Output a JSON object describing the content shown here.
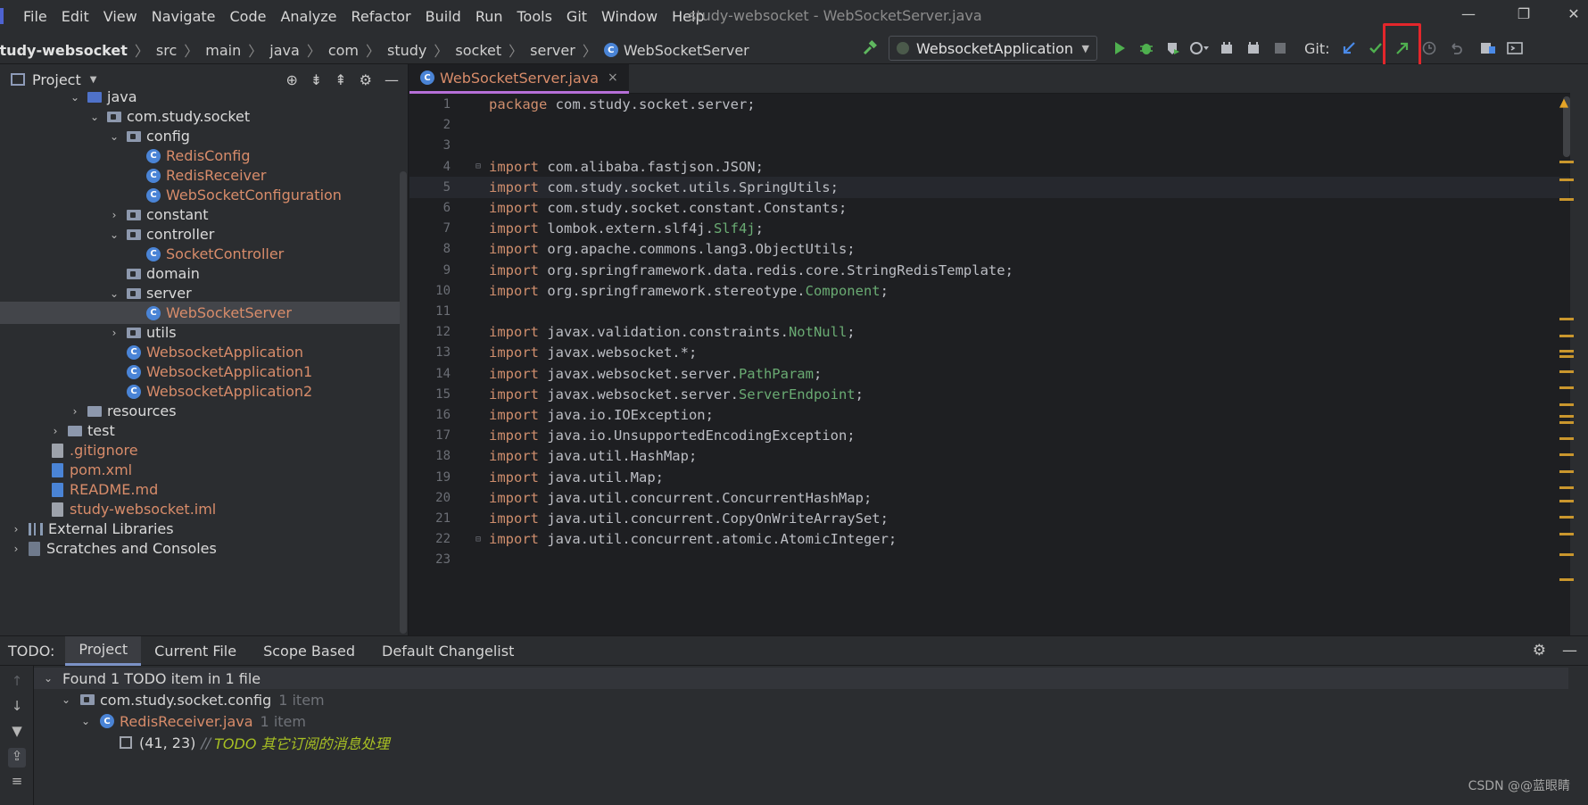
{
  "menu": {
    "items": [
      "File",
      "Edit",
      "View",
      "Navigate",
      "Code",
      "Analyze",
      "Refactor",
      "Build",
      "Run",
      "Tools",
      "Git",
      "Window",
      "Help"
    ],
    "window_title": "study-websocket - WebSocketServer.java",
    "minimize": "—",
    "restore": "❐",
    "close": "✕"
  },
  "breadcrumb": {
    "project": "study-websocket",
    "parts": [
      "src",
      "main",
      "java",
      "com",
      "study",
      "socket",
      "server"
    ],
    "class_icon": "C",
    "current": "WebSocketServer"
  },
  "toolbar": {
    "run_config": "WebsocketApplication",
    "git_label": "Git:",
    "icons": [
      "hammer-icon",
      "run-icon",
      "debug-icon",
      "coverage-icon",
      "profile-icon",
      "build-icon",
      "stop-icon",
      "git-update-icon",
      "git-commit-icon",
      "git-push-icon",
      "history-icon",
      "rollback-icon",
      "project-structure-icon",
      "terminal-icon"
    ]
  },
  "project_panel": {
    "title": "Project",
    "tree": [
      {
        "label": "java",
        "kind": "src-folder",
        "expanded": true
      },
      {
        "label": "com.study.socket",
        "kind": "package",
        "expanded": true
      },
      {
        "label": "config",
        "kind": "package",
        "expanded": true
      },
      {
        "label": "RedisConfig",
        "kind": "class"
      },
      {
        "label": "RedisReceiver",
        "kind": "class"
      },
      {
        "label": "WebSocketConfiguration",
        "kind": "class"
      },
      {
        "label": "constant",
        "kind": "package",
        "expanded": false
      },
      {
        "label": "controller",
        "kind": "package",
        "expanded": true
      },
      {
        "label": "SocketController",
        "kind": "class"
      },
      {
        "label": "domain",
        "kind": "package"
      },
      {
        "label": "server",
        "kind": "package",
        "expanded": true
      },
      {
        "label": "WebSocketServer",
        "kind": "class",
        "selected": true
      },
      {
        "label": "utils",
        "kind": "package",
        "expanded": false
      },
      {
        "label": "WebsocketApplication",
        "kind": "app-class"
      },
      {
        "label": "WebsocketApplication1",
        "kind": "app-class"
      },
      {
        "label": "WebsocketApplication2",
        "kind": "app-class"
      },
      {
        "label": "resources",
        "kind": "folder",
        "expanded": false
      },
      {
        "label": "test",
        "kind": "folder",
        "expanded": false
      },
      {
        "label": ".gitignore",
        "kind": "file"
      },
      {
        "label": "pom.xml",
        "kind": "file"
      },
      {
        "label": "README.md",
        "kind": "file"
      },
      {
        "label": "study-websocket.iml",
        "kind": "file"
      },
      {
        "label": "External Libraries",
        "kind": "library",
        "expanded": false
      },
      {
        "label": "Scratches and Consoles",
        "kind": "scratch",
        "expanded": false
      }
    ]
  },
  "editor": {
    "tab_label": "WebSocketServer.java",
    "tab_close": "×",
    "lines": [
      {
        "num": "1",
        "parts": [
          [
            "kw",
            "package"
          ],
          [
            "",
            "  com.study.socket.server;"
          ]
        ]
      },
      {
        "num": "2",
        "parts": []
      },
      {
        "num": "3",
        "parts": []
      },
      {
        "num": "4",
        "parts": [
          [
            "kw",
            "import"
          ],
          [
            "",
            "  com.alibaba.fastjson.JSON;"
          ]
        ]
      },
      {
        "num": "5",
        "parts": [
          [
            "kw",
            "import"
          ],
          [
            "",
            "  com.study.socket.utils.SpringUtils;"
          ]
        ]
      },
      {
        "num": "6",
        "parts": [
          [
            "kw",
            "import"
          ],
          [
            "",
            "  com.study.socket.constant.Constants;"
          ]
        ]
      },
      {
        "num": "7",
        "parts": [
          [
            "kw",
            "import"
          ],
          [
            "",
            "  lombok.extern.slf4j."
          ],
          [
            "ann",
            "Slf4j"
          ],
          [
            "",
            ";"
          ]
        ]
      },
      {
        "num": "8",
        "parts": [
          [
            "kw",
            "import"
          ],
          [
            "",
            "  org.apache.commons.lang3.ObjectUtils;"
          ]
        ]
      },
      {
        "num": "9",
        "parts": [
          [
            "kw",
            "import"
          ],
          [
            "",
            "  org.springframework.data.redis.core.StringRedisTemplate;"
          ]
        ]
      },
      {
        "num": "10",
        "parts": [
          [
            "kw",
            "import"
          ],
          [
            "",
            "  org.springframework.stereotype."
          ],
          [
            "ann",
            "Component"
          ],
          [
            "",
            ";"
          ]
        ]
      },
      {
        "num": "11",
        "parts": []
      },
      {
        "num": "12",
        "parts": [
          [
            "kw",
            "import"
          ],
          [
            "",
            "  javax.validation.constraints."
          ],
          [
            "ann",
            "NotNull"
          ],
          [
            "",
            ";"
          ]
        ]
      },
      {
        "num": "13",
        "parts": [
          [
            "kw",
            "import"
          ],
          [
            "",
            "  javax.websocket.*;"
          ]
        ]
      },
      {
        "num": "14",
        "parts": [
          [
            "kw",
            "import"
          ],
          [
            "",
            "  javax.websocket.server."
          ],
          [
            "ann",
            "PathParam"
          ],
          [
            "",
            ";"
          ]
        ]
      },
      {
        "num": "15",
        "parts": [
          [
            "kw",
            "import"
          ],
          [
            "",
            "  javax.websocket.server."
          ],
          [
            "ann",
            "ServerEndpoint"
          ],
          [
            "",
            ";"
          ]
        ]
      },
      {
        "num": "16",
        "parts": [
          [
            "kw",
            "import"
          ],
          [
            "",
            "  java.io.IOException;"
          ]
        ]
      },
      {
        "num": "17",
        "parts": [
          [
            "kw",
            "import"
          ],
          [
            "",
            "  java.io.UnsupportedEncodingException;"
          ]
        ]
      },
      {
        "num": "18",
        "parts": [
          [
            "kw",
            "import"
          ],
          [
            "",
            "  java.util.HashMap;"
          ]
        ]
      },
      {
        "num": "19",
        "parts": [
          [
            "kw",
            "import"
          ],
          [
            "",
            "  java.util.Map;"
          ]
        ]
      },
      {
        "num": "20",
        "parts": [
          [
            "kw",
            "import"
          ],
          [
            "",
            "  java.util.concurrent.ConcurrentHashMap;"
          ]
        ]
      },
      {
        "num": "21",
        "parts": [
          [
            "kw",
            "import"
          ],
          [
            "",
            "  java.util.concurrent.CopyOnWriteArraySet;"
          ]
        ]
      },
      {
        "num": "22",
        "parts": [
          [
            "kw",
            "import"
          ],
          [
            "",
            "  java.util.concurrent.atomic.AtomicInteger;"
          ]
        ]
      },
      {
        "num": "23",
        "parts": []
      }
    ]
  },
  "todo": {
    "label": "TODO:",
    "tabs": [
      "Project",
      "Current File",
      "Scope Based",
      "Default Changelist"
    ],
    "active_tab": "Project",
    "summary": "Found 1 TODO item in 1 file",
    "package": "com.study.socket.config",
    "package_count": "1 item",
    "file": "RedisReceiver.java",
    "file_count": "1 item",
    "item_pos": "(41, 23)",
    "item_comment": "//",
    "item_text": "TODO 其它订阅的消息处理"
  },
  "watermark": "CSDN @@蓝眼睛",
  "colors": {
    "highlight_box": "#e3262b",
    "accent_tab": "#b66fd8",
    "file_modified": "#d88c6a",
    "keyword": "#cf8e6d",
    "annotation": "#6aab73"
  }
}
